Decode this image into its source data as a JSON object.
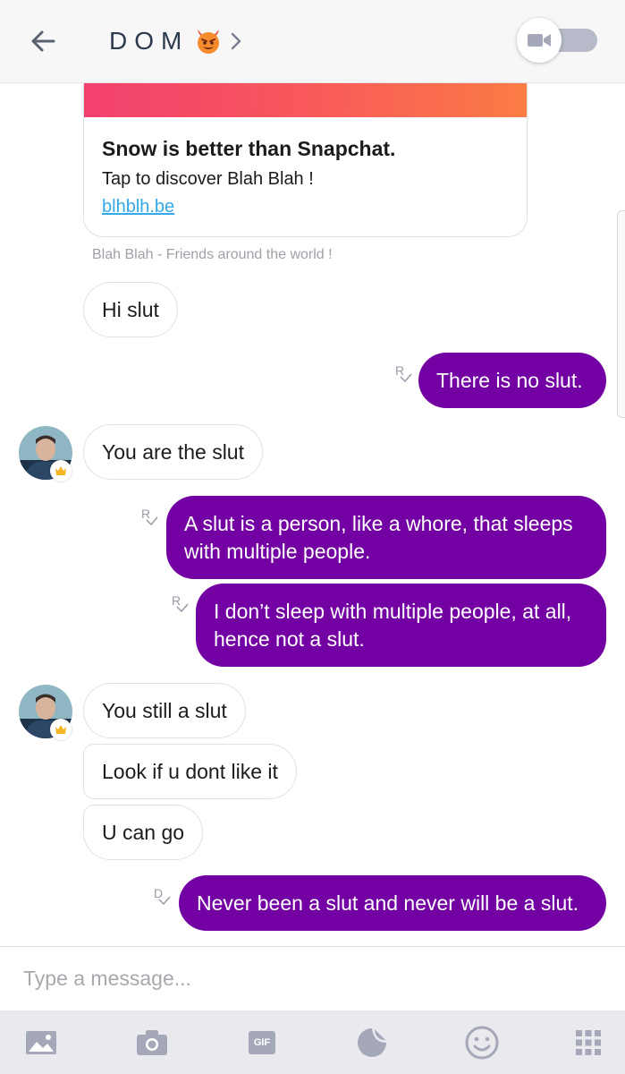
{
  "header": {
    "title": "DOM"
  },
  "promo": {
    "title": "Snow is better than Snapchat.",
    "subtitle": "Tap to discover Blah Blah !",
    "link": "blhblh.be",
    "caption": "Blah Blah - Friends around the world !"
  },
  "messages": {
    "m1": "Hi slut",
    "m2": "There is no slut.",
    "m3": "You are the slut",
    "m4": "A slut is a person, like a whore, that sleeps with multiple people.",
    "m5": "I don’t sleep with multiple people, at all, hence not a slut.",
    "m6": "You still a slut",
    "m7": "Look if u dont like it",
    "m8": "U can go",
    "m9": "Never been a slut and never will be a slut."
  },
  "receipts": {
    "read": "R",
    "delivered": "D"
  },
  "composer": {
    "placeholder": "Type a message..."
  },
  "toolbar": {
    "gif_label": "GIF"
  },
  "colors": {
    "outgoing_bubble": "#7300a3",
    "header_bg": "#f7f7f7",
    "toolbar_bg": "#e9e9ee",
    "link": "#34a8e8"
  }
}
